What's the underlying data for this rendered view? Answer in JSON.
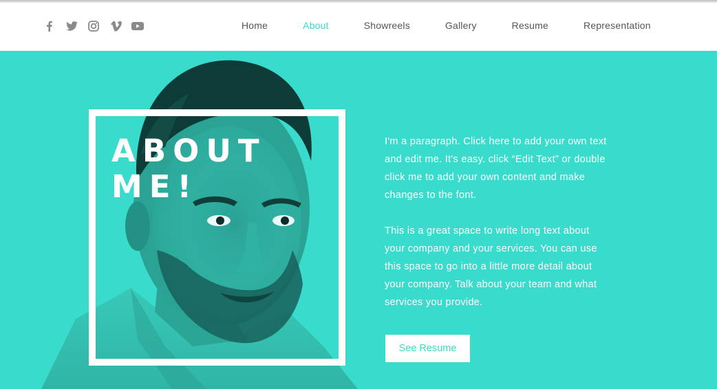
{
  "header": {
    "social": [
      {
        "icon": "facebook-icon"
      },
      {
        "icon": "twitter-icon"
      },
      {
        "icon": "instagram-icon"
      },
      {
        "icon": "vimeo-icon"
      },
      {
        "icon": "youtube-icon"
      }
    ],
    "nav": [
      {
        "label": "Home"
      },
      {
        "label": "About",
        "active": true
      },
      {
        "label": "Showreels"
      },
      {
        "label": "Gallery"
      },
      {
        "label": "Resume"
      },
      {
        "label": "Representation"
      }
    ]
  },
  "hero": {
    "title_line1": "ABOUT",
    "title_line2": "ME!",
    "paragraph1": "I'm a paragraph. Click here to add your own text and edit me. It's easy. click “Edit Text” or double click me to add your own content and make changes to the font.",
    "paragraph2": "This is a great space to write long text about your company and your services. You can use this space to go into a little more detail about your company. Talk about your team and what services you provide.",
    "button_label": "See Resume"
  },
  "colors": {
    "accent": "#3bd9c6",
    "hero_bg": "#39dccc",
    "nav_text": "#555555",
    "icon_gray": "#8a8a8a"
  }
}
